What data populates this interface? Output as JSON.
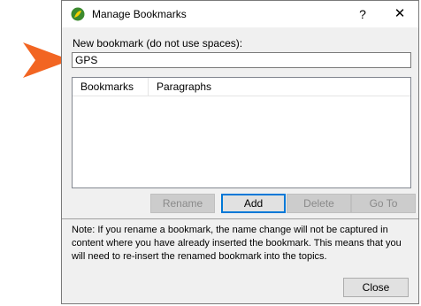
{
  "window": {
    "title": "Manage Bookmarks",
    "help_glyph": "?",
    "close_glyph": "✕"
  },
  "form": {
    "label": "New bookmark (do not use spaces):",
    "value": "GPS"
  },
  "list": {
    "columns": [
      "Bookmarks",
      "Paragraphs"
    ],
    "rows": []
  },
  "buttons": {
    "rename": "Rename",
    "add": "Add",
    "delete": "Delete",
    "goto": "Go To",
    "close": "Close"
  },
  "note": "Note: If you rename a bookmark, the name change will not be captured in content where you have already inserted the bookmark. This means that you will need to re-insert the renamed bookmark into the topics.",
  "colors": {
    "arrow": "#f26522",
    "focus": "#0078d7",
    "icon_green": "#3c8a2e",
    "icon_yellow": "#f5d000"
  }
}
